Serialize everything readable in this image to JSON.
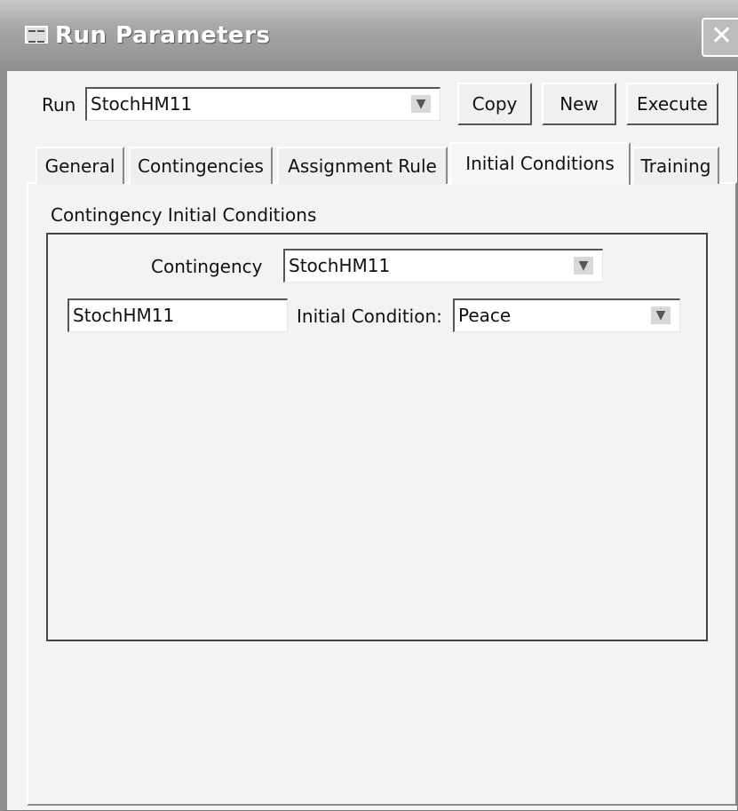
{
  "window": {
    "title": "Run Parameters",
    "close_icon": "close-icon"
  },
  "run": {
    "label": "Run",
    "value": "StochHM11"
  },
  "buttons": {
    "copy": "Copy",
    "new": "New",
    "execute": "Execute"
  },
  "tabs": [
    {
      "label": "General"
    },
    {
      "label": "Contingencies"
    },
    {
      "label": "Assignment Rule"
    },
    {
      "label": "Initial Conditions",
      "active": true
    },
    {
      "label": "Training"
    }
  ],
  "panel": {
    "group_title": "Contingency Initial Conditions",
    "contingency_label": "Contingency",
    "contingency_value": "StochHM11",
    "name_value": "StochHM11",
    "initial_condition_label": "Initial Condition:",
    "initial_condition_value": "Peace"
  }
}
